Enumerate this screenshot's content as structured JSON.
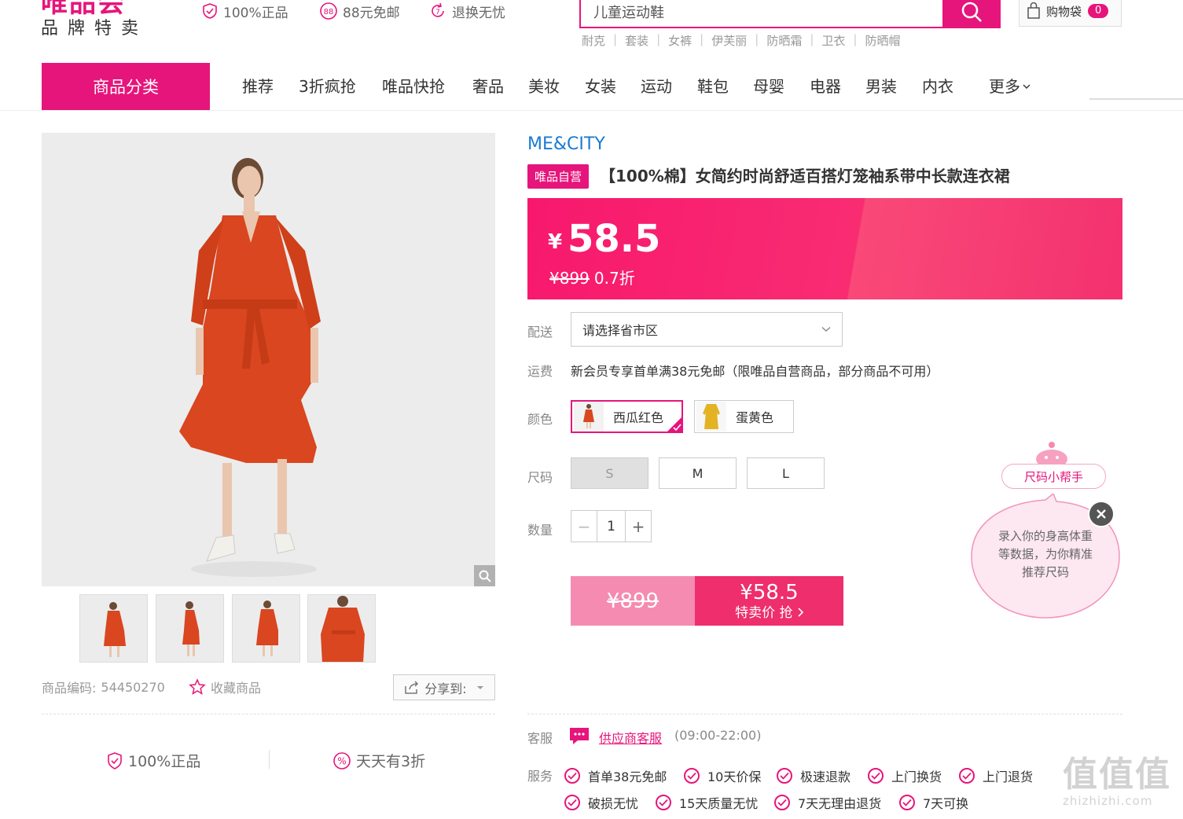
{
  "header": {
    "logo": "唯品会",
    "logo_sub": "品牌特卖",
    "promises": [
      "100%正品",
      "88元免邮",
      "退换无忧"
    ],
    "search_value": "儿童运动鞋",
    "hotwords": [
      "耐克",
      "套装",
      "女裤",
      "伊芙丽",
      "防晒霜",
      "卫衣",
      "防晒帽"
    ],
    "cart_label": "购物袋",
    "cart_count": "0"
  },
  "nav": {
    "category_label": "商品分类",
    "items": [
      "推荐",
      "3折疯抢",
      "唯品快抢",
      "奢品",
      "美妆",
      "女装",
      "运动",
      "鞋包",
      "母婴",
      "电器",
      "男装",
      "内衣"
    ],
    "more_label": "更多"
  },
  "gallery": {
    "product_code_label": "商品编码:",
    "product_code": "54450270",
    "favorite_label": "收藏商品",
    "share_label": "分享到:",
    "guarantees": [
      "100%正品",
      "天天有3折"
    ]
  },
  "product": {
    "brand": "ME&CITY",
    "self_tag": "唯品自营",
    "title": "【100%棉】女简约时尚舒适百搭灯笼袖系带中长款连衣裙",
    "currency": "¥",
    "price": "58.5",
    "original_price": "¥899",
    "discount": "0.7折",
    "delivery_label": "配送",
    "delivery_placeholder": "请选择省市区",
    "shipping_label": "运费",
    "shipping_text": "新会员专享首单满38元免邮（限唯品自营商品，部分商品不可用）",
    "color_label": "颜色",
    "colors": [
      "西瓜红色",
      "蛋黄色"
    ],
    "size_label": "尺码",
    "sizes": [
      "S",
      "M",
      "L"
    ],
    "qty_label": "数量",
    "qty": "1",
    "buy_old_price": "¥899",
    "buy_price": "¥58.5",
    "buy_text": "特卖价 抢"
  },
  "size_helper": {
    "tag": "尺码小帮手",
    "bubble": "录入你的身高体重等数据，为你精准推荐尺码"
  },
  "service": {
    "cs_label": "客服",
    "cs_link": "供应商客服",
    "cs_hours": "(09:00-22:00)",
    "svc_label": "服务",
    "items": [
      "首单38元免邮",
      "10天价保",
      "极速退款",
      "上门换货",
      "上门退货",
      "破损无忧",
      "15天质量无忧",
      "7天无理由退货",
      "7天可换"
    ]
  },
  "watermark": {
    "big": "值值值",
    "small": "zhizhizhi.com"
  },
  "colors": {
    "accent": "#e6157b",
    "brand_link": "#1a7bd1",
    "price_band": "#f7186d",
    "dress": "#d9461f"
  }
}
